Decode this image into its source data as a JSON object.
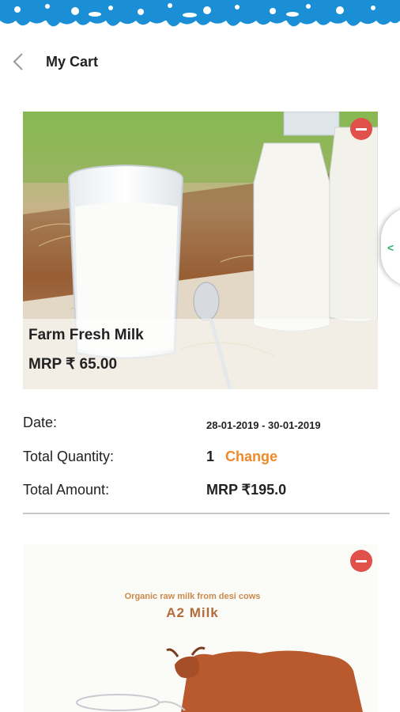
{
  "header": {
    "title": "My Cart"
  },
  "cart_items": [
    {
      "name": "Farm Fresh Milk",
      "price": "MRP ₹ 65.00",
      "date_label": "Date:",
      "date_value": "28-01-2019 - 30-01-2019",
      "quantity_label": "Total Quantity:",
      "quantity_value": "1",
      "change_label": "Change",
      "amount_label": "Total Amount:",
      "amount_value": "MRP ₹195.0"
    },
    {
      "banner_tagline": "Organic raw milk from desi cows",
      "banner_title": "A2 Milk"
    }
  ],
  "icons": {
    "back": "chevron-left-icon",
    "remove": "minus-circle-icon",
    "side_tab": "chevron-left-icon"
  },
  "colors": {
    "splash_blue": "#1a8fd6",
    "remove_red": "#e0514b",
    "change_orange": "#f0892a",
    "side_tab_green": "#2fb36b"
  }
}
